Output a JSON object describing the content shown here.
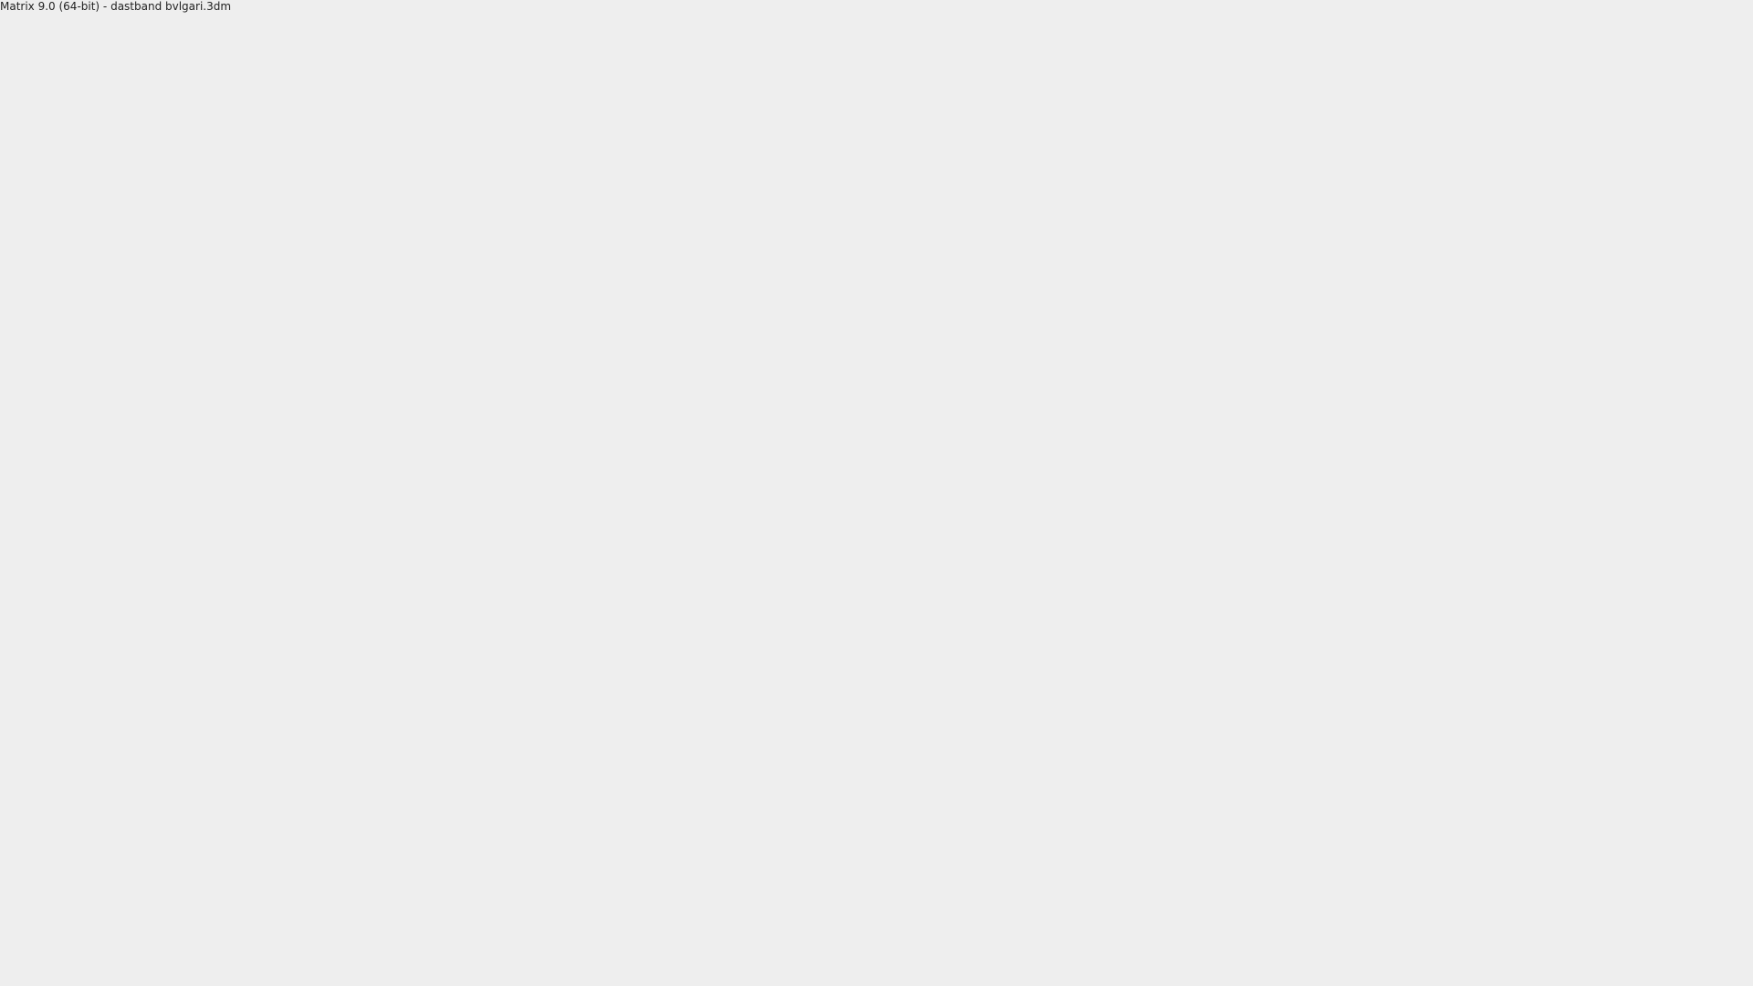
{
  "title": "Matrix 9.0 (64-bit) - dastband bvlgari.3dm"
}
